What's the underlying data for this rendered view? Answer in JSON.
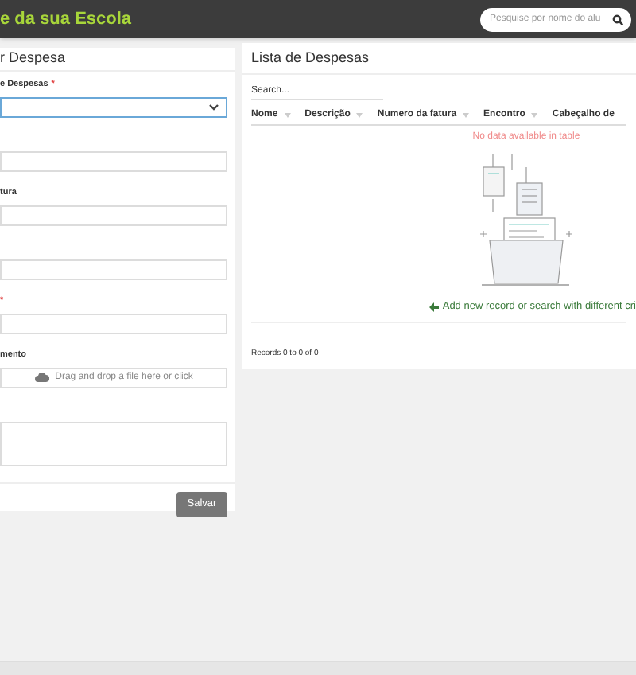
{
  "header": {
    "title": "e da sua Escola",
    "search": {
      "placeholder": "Pesquise por nome do alu"
    }
  },
  "form": {
    "title": "r Despesa",
    "fields": [
      {
        "kind": "select",
        "label": "e Despesas",
        "required_mark": "*",
        "focused": true
      },
      {
        "kind": "text",
        "focused": false
      },
      {
        "kind": "text",
        "label": "tura",
        "focused": false
      },
      {
        "kind": "text",
        "focused": false
      },
      {
        "kind": "text",
        "required_mark": "*",
        "focused": false
      },
      {
        "kind": "file",
        "label": "mento",
        "placeholder": "Drag and drop a file here or click",
        "focused": false
      },
      {
        "kind": "textarea",
        "focused": false
      }
    ],
    "save_button": "Salvar"
  },
  "list": {
    "title": "Lista de Despesas",
    "search": {
      "placeholder": "Search..."
    },
    "columns": [
      "Nome",
      "Descrição",
      "Numero da fatura",
      "Encontro",
      "Cabeçalho de"
    ],
    "empty_message": "No data available in table",
    "add_link": "Add new record or search with different cri",
    "records": "Records 0 to 0 of 0"
  }
}
